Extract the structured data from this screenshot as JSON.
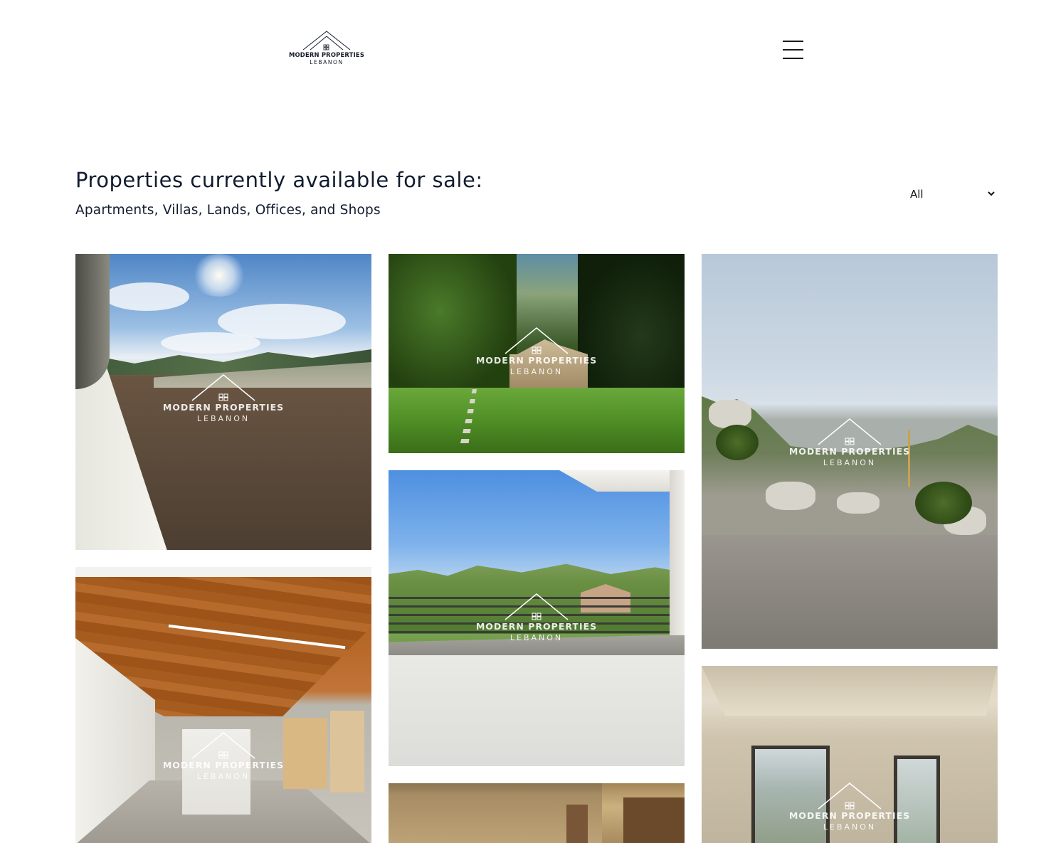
{
  "header": {
    "logo_line1": "MODERN PROPERTIES",
    "logo_line2": "LEBANON",
    "menu_icon": "hamburger-menu-icon"
  },
  "main": {
    "title": "Properties currently available for sale:",
    "subtitle": "Apartments, Villas, Lands, Offices, and Shops",
    "filter": {
      "selected": "All",
      "icon": "chevron-down-icon"
    }
  },
  "watermark": {
    "line1": "MODERN PROPERTIES",
    "line2": "LEBANON"
  },
  "listings": [
    {
      "scene": "land with sky and wall"
    },
    {
      "scene": "villa with garden lawn"
    },
    {
      "scene": "rocky hillside land by road"
    },
    {
      "scene": "office corridor with wooden ceiling"
    },
    {
      "scene": "apartment balcony with mountain view"
    },
    {
      "scene": "room with window blinds"
    },
    {
      "scene": "empty room with glass doors"
    }
  ],
  "colors": {
    "text_primary": "#111c30",
    "background": "#ffffff"
  }
}
